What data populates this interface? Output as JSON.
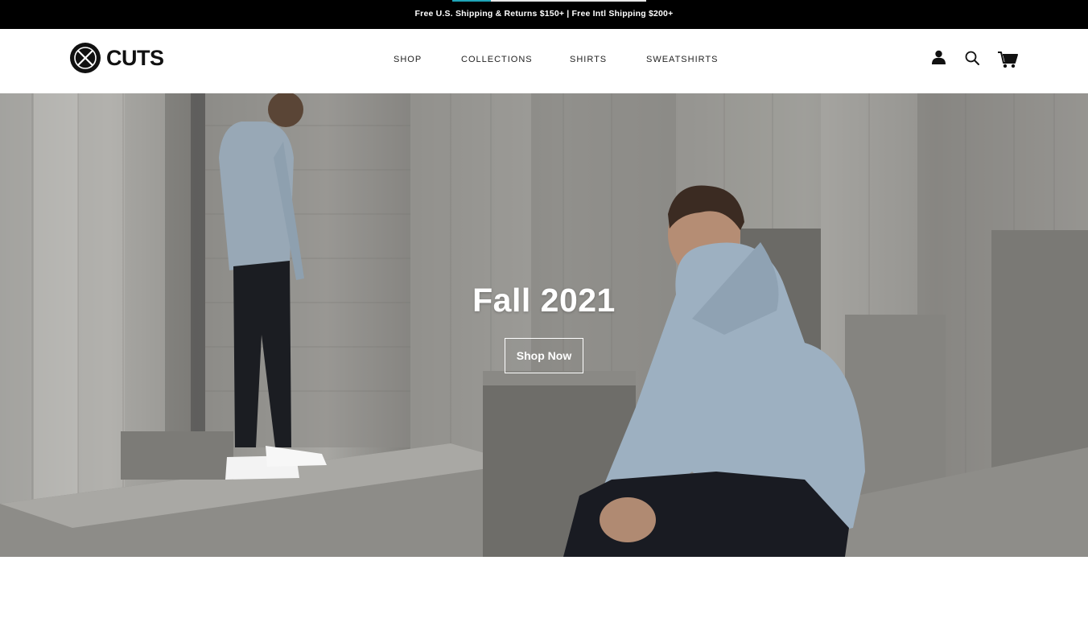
{
  "announcement": {
    "text": "Free U.S. Shipping & Returns $150+ | Free Intl Shipping $200+",
    "progress": 0.2,
    "progress_color": "#1fa5b8"
  },
  "header": {
    "logo_text": "CUTS",
    "nav": [
      {
        "label": "SHOP"
      },
      {
        "label": "COLLECTIONS"
      },
      {
        "label": "SHIRTS"
      },
      {
        "label": "SWEATSHIRTS"
      }
    ],
    "icons": [
      "account-icon",
      "search-icon",
      "cart-icon"
    ]
  },
  "hero": {
    "title": "Fall 2021",
    "cta_label": "Shop Now"
  },
  "colors": {
    "bar": "#000000",
    "text_dark": "#111111",
    "hero_text": "#ffffff"
  }
}
